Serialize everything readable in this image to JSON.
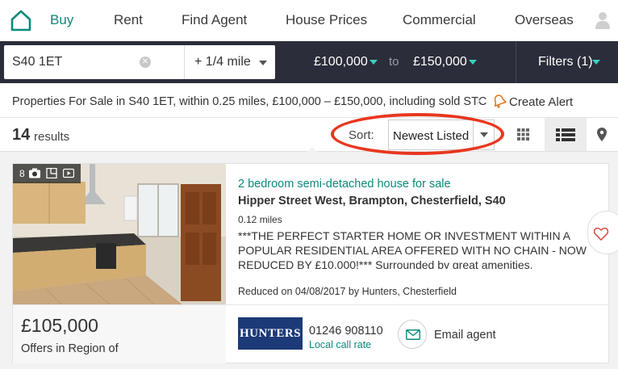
{
  "colors": {
    "accent": "#0a8a7a",
    "dark_bar": "#2b2d3a",
    "teal_caret": "#3ad0c0",
    "highlight": "#e8371f",
    "agent_logo_bg": "#1d3a78"
  },
  "nav": {
    "logo_icon": "home-outline-icon",
    "items": [
      {
        "label": "Buy",
        "active": true
      },
      {
        "label": "Rent"
      },
      {
        "label": "Find Agent"
      },
      {
        "label": "House Prices"
      },
      {
        "label": "Commercial"
      },
      {
        "label": "Overseas"
      }
    ],
    "user_icon": "user-silhouette-icon"
  },
  "search": {
    "location": "S40 1ET",
    "radius": "+ 1/4 mile",
    "min_price": "£100,000",
    "to_label": "to",
    "max_price": "£150,000",
    "filters_label": "Filters (1)"
  },
  "breadcrumb": {
    "text": "Properties For Sale in S40 1ET, within 0.25 miles, £100,000 – £150,000, including sold STC",
    "create_alert": "Create Alert"
  },
  "results": {
    "count": "14",
    "count_label": "results",
    "sort_label": "Sort:",
    "sort_value": "Newest Listed",
    "active_view": "list"
  },
  "listing": {
    "photo_count": "8",
    "title": "2 bedroom semi-detached house for sale",
    "address": "Hipper Street West, Brampton, Chesterfield, S40",
    "distance": "0.12 miles",
    "description": "***THE PERFECT STARTER HOME OR INVESTMENT WITHIN A POPULAR RESIDENTIAL AREA OFFERED WITH NO CHAIN - NOW REDUCED BY £10,000!*** Surrounded by great amenities.",
    "reduced": "Reduced on 04/08/2017 by Hunters, Chesterfield",
    "price": "£105,000",
    "price_qualifier": "Offers in Region of",
    "agent_logo_text": "HUNTERS",
    "phone": "01246 908110",
    "local_rate": "Local call rate",
    "email_agent": "Email agent"
  }
}
